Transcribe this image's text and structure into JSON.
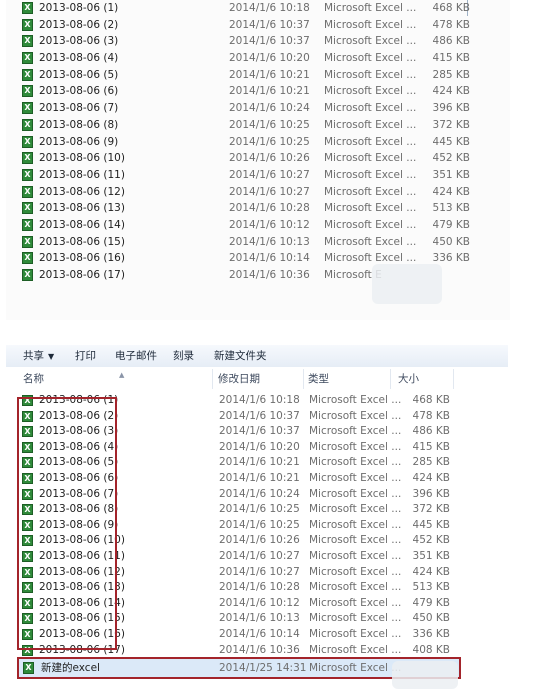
{
  "top_panel": {
    "files": [
      {
        "name": "2013-08-06  (1)",
        "date": "2014/1/6 10:18",
        "type": "Microsoft Excel ...",
        "size": "468 KB"
      },
      {
        "name": "2013-08-06  (2)",
        "date": "2014/1/6 10:37",
        "type": "Microsoft Excel ...",
        "size": "478 KB"
      },
      {
        "name": "2013-08-06  (3)",
        "date": "2014/1/6 10:37",
        "type": "Microsoft Excel ...",
        "size": "486 KB"
      },
      {
        "name": "2013-08-06  (4)",
        "date": "2014/1/6 10:20",
        "type": "Microsoft Excel ...",
        "size": "415 KB"
      },
      {
        "name": "2013-08-06  (5)",
        "date": "2014/1/6 10:21",
        "type": "Microsoft Excel ...",
        "size": "285 KB"
      },
      {
        "name": "2013-08-06  (6)",
        "date": "2014/1/6 10:21",
        "type": "Microsoft Excel ...",
        "size": "424 KB"
      },
      {
        "name": "2013-08-06  (7)",
        "date": "2014/1/6 10:24",
        "type": "Microsoft Excel ...",
        "size": "396 KB"
      },
      {
        "name": "2013-08-06  (8)",
        "date": "2014/1/6 10:25",
        "type": "Microsoft Excel ...",
        "size": "372 KB"
      },
      {
        "name": "2013-08-06  (9)",
        "date": "2014/1/6 10:25",
        "type": "Microsoft Excel ...",
        "size": "445 KB"
      },
      {
        "name": "2013-08-06  (10)",
        "date": "2014/1/6 10:26",
        "type": "Microsoft Excel ...",
        "size": "452 KB"
      },
      {
        "name": "2013-08-06  (11)",
        "date": "2014/1/6 10:27",
        "type": "Microsoft Excel ...",
        "size": "351 KB"
      },
      {
        "name": "2013-08-06  (12)",
        "date": "2014/1/6 10:27",
        "type": "Microsoft Excel ...",
        "size": "424 KB"
      },
      {
        "name": "2013-08-06  (13)",
        "date": "2014/1/6 10:28",
        "type": "Microsoft Excel ...",
        "size": "513 KB"
      },
      {
        "name": "2013-08-06  (14)",
        "date": "2014/1/6 10:12",
        "type": "Microsoft Excel ...",
        "size": "479 KB"
      },
      {
        "name": "2013-08-06  (15)",
        "date": "2014/1/6 10:13",
        "type": "Microsoft Excel ...",
        "size": "450 KB"
      },
      {
        "name": "2013-08-06  (16)",
        "date": "2014/1/6 10:14",
        "type": "Microsoft Excel ...",
        "size": "336 KB"
      },
      {
        "name": "2013-08-06  (17)",
        "date": "2014/1/6 10:36",
        "type": "Microsoft E",
        "size": ""
      }
    ]
  },
  "bottom_panel": {
    "toolbar": {
      "share": "共享",
      "print": "打印",
      "email": "电子邮件",
      "burn": "刻录",
      "new_folder": "新建文件夹"
    },
    "headers": {
      "name": "名称",
      "date": "修改日期",
      "type": "类型",
      "size": "大小"
    },
    "files": [
      {
        "name": "2013-08-06  (1)",
        "date": "2014/1/6 10:18",
        "type": "Microsoft Excel ...",
        "size": "468 KB"
      },
      {
        "name": "2013-08-06  (2)",
        "date": "2014/1/6 10:37",
        "type": "Microsoft Excel ...",
        "size": "478 KB"
      },
      {
        "name": "2013-08-06  (3)",
        "date": "2014/1/6 10:37",
        "type": "Microsoft Excel ...",
        "size": "486 KB"
      },
      {
        "name": "2013-08-06  (4)",
        "date": "2014/1/6 10:20",
        "type": "Microsoft Excel ...",
        "size": "415 KB"
      },
      {
        "name": "2013-08-06  (5)",
        "date": "2014/1/6 10:21",
        "type": "Microsoft Excel ...",
        "size": "285 KB"
      },
      {
        "name": "2013-08-06  (6)",
        "date": "2014/1/6 10:21",
        "type": "Microsoft Excel ...",
        "size": "424 KB"
      },
      {
        "name": "2013-08-06  (7)",
        "date": "2014/1/6 10:24",
        "type": "Microsoft Excel ...",
        "size": "396 KB"
      },
      {
        "name": "2013-08-06  (8)",
        "date": "2014/1/6 10:25",
        "type": "Microsoft Excel ...",
        "size": "372 KB"
      },
      {
        "name": "2013-08-06  (9)",
        "date": "2014/1/6 10:25",
        "type": "Microsoft Excel ...",
        "size": "445 KB"
      },
      {
        "name": "2013-08-06  (10)",
        "date": "2014/1/6 10:26",
        "type": "Microsoft Excel ...",
        "size": "452 KB"
      },
      {
        "name": "2013-08-06  (11)",
        "date": "2014/1/6 10:27",
        "type": "Microsoft Excel ...",
        "size": "351 KB"
      },
      {
        "name": "2013-08-06  (12)",
        "date": "2014/1/6 10:27",
        "type": "Microsoft Excel ...",
        "size": "424 KB"
      },
      {
        "name": "2013-08-06  (13)",
        "date": "2014/1/6 10:28",
        "type": "Microsoft Excel ...",
        "size": "513 KB"
      },
      {
        "name": "2013-08-06  (14)",
        "date": "2014/1/6 10:12",
        "type": "Microsoft Excel ...",
        "size": "479 KB"
      },
      {
        "name": "2013-08-06  (15)",
        "date": "2014/1/6 10:13",
        "type": "Microsoft Excel ...",
        "size": "450 KB"
      },
      {
        "name": "2013-08-06  (16)",
        "date": "2014/1/6 10:14",
        "type": "Microsoft Excel ...",
        "size": "336 KB"
      },
      {
        "name": "2013-08-06  (17)",
        "date": "2014/1/6 10:36",
        "type": "Microsoft Excel ...",
        "size": "408 KB"
      }
    ],
    "new_file": {
      "name": "新建的excel",
      "date": "2014/1/25 14:31",
      "type": "Microsoft Excel ..."
    }
  },
  "icons": {
    "excel": "excel-file-icon",
    "sort": "sort-up-icon",
    "dropdown": "caret-down-icon"
  },
  "colors": {
    "highlight": "#a3242b",
    "selection": "#dbe9f8",
    "excel_green": "#2f8a3a"
  }
}
